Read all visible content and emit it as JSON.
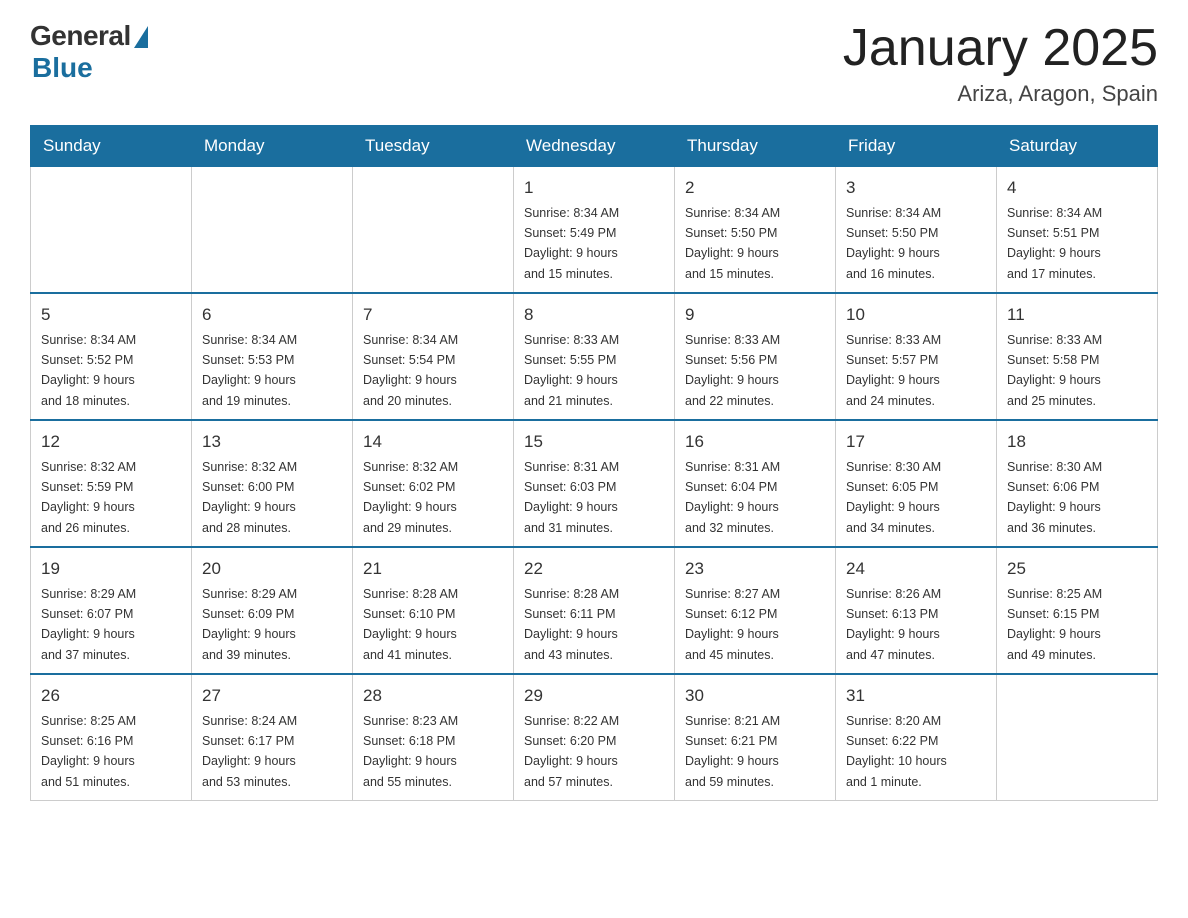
{
  "header": {
    "logo_general": "General",
    "logo_blue": "Blue",
    "title": "January 2025",
    "location": "Ariza, Aragon, Spain"
  },
  "days_of_week": [
    "Sunday",
    "Monday",
    "Tuesday",
    "Wednesday",
    "Thursday",
    "Friday",
    "Saturday"
  ],
  "weeks": [
    [
      {
        "day": "",
        "info": ""
      },
      {
        "day": "",
        "info": ""
      },
      {
        "day": "",
        "info": ""
      },
      {
        "day": "1",
        "info": "Sunrise: 8:34 AM\nSunset: 5:49 PM\nDaylight: 9 hours\nand 15 minutes."
      },
      {
        "day": "2",
        "info": "Sunrise: 8:34 AM\nSunset: 5:50 PM\nDaylight: 9 hours\nand 15 minutes."
      },
      {
        "day": "3",
        "info": "Sunrise: 8:34 AM\nSunset: 5:50 PM\nDaylight: 9 hours\nand 16 minutes."
      },
      {
        "day": "4",
        "info": "Sunrise: 8:34 AM\nSunset: 5:51 PM\nDaylight: 9 hours\nand 17 minutes."
      }
    ],
    [
      {
        "day": "5",
        "info": "Sunrise: 8:34 AM\nSunset: 5:52 PM\nDaylight: 9 hours\nand 18 minutes."
      },
      {
        "day": "6",
        "info": "Sunrise: 8:34 AM\nSunset: 5:53 PM\nDaylight: 9 hours\nand 19 minutes."
      },
      {
        "day": "7",
        "info": "Sunrise: 8:34 AM\nSunset: 5:54 PM\nDaylight: 9 hours\nand 20 minutes."
      },
      {
        "day": "8",
        "info": "Sunrise: 8:33 AM\nSunset: 5:55 PM\nDaylight: 9 hours\nand 21 minutes."
      },
      {
        "day": "9",
        "info": "Sunrise: 8:33 AM\nSunset: 5:56 PM\nDaylight: 9 hours\nand 22 minutes."
      },
      {
        "day": "10",
        "info": "Sunrise: 8:33 AM\nSunset: 5:57 PM\nDaylight: 9 hours\nand 24 minutes."
      },
      {
        "day": "11",
        "info": "Sunrise: 8:33 AM\nSunset: 5:58 PM\nDaylight: 9 hours\nand 25 minutes."
      }
    ],
    [
      {
        "day": "12",
        "info": "Sunrise: 8:32 AM\nSunset: 5:59 PM\nDaylight: 9 hours\nand 26 minutes."
      },
      {
        "day": "13",
        "info": "Sunrise: 8:32 AM\nSunset: 6:00 PM\nDaylight: 9 hours\nand 28 minutes."
      },
      {
        "day": "14",
        "info": "Sunrise: 8:32 AM\nSunset: 6:02 PM\nDaylight: 9 hours\nand 29 minutes."
      },
      {
        "day": "15",
        "info": "Sunrise: 8:31 AM\nSunset: 6:03 PM\nDaylight: 9 hours\nand 31 minutes."
      },
      {
        "day": "16",
        "info": "Sunrise: 8:31 AM\nSunset: 6:04 PM\nDaylight: 9 hours\nand 32 minutes."
      },
      {
        "day": "17",
        "info": "Sunrise: 8:30 AM\nSunset: 6:05 PM\nDaylight: 9 hours\nand 34 minutes."
      },
      {
        "day": "18",
        "info": "Sunrise: 8:30 AM\nSunset: 6:06 PM\nDaylight: 9 hours\nand 36 minutes."
      }
    ],
    [
      {
        "day": "19",
        "info": "Sunrise: 8:29 AM\nSunset: 6:07 PM\nDaylight: 9 hours\nand 37 minutes."
      },
      {
        "day": "20",
        "info": "Sunrise: 8:29 AM\nSunset: 6:09 PM\nDaylight: 9 hours\nand 39 minutes."
      },
      {
        "day": "21",
        "info": "Sunrise: 8:28 AM\nSunset: 6:10 PM\nDaylight: 9 hours\nand 41 minutes."
      },
      {
        "day": "22",
        "info": "Sunrise: 8:28 AM\nSunset: 6:11 PM\nDaylight: 9 hours\nand 43 minutes."
      },
      {
        "day": "23",
        "info": "Sunrise: 8:27 AM\nSunset: 6:12 PM\nDaylight: 9 hours\nand 45 minutes."
      },
      {
        "day": "24",
        "info": "Sunrise: 8:26 AM\nSunset: 6:13 PM\nDaylight: 9 hours\nand 47 minutes."
      },
      {
        "day": "25",
        "info": "Sunrise: 8:25 AM\nSunset: 6:15 PM\nDaylight: 9 hours\nand 49 minutes."
      }
    ],
    [
      {
        "day": "26",
        "info": "Sunrise: 8:25 AM\nSunset: 6:16 PM\nDaylight: 9 hours\nand 51 minutes."
      },
      {
        "day": "27",
        "info": "Sunrise: 8:24 AM\nSunset: 6:17 PM\nDaylight: 9 hours\nand 53 minutes."
      },
      {
        "day": "28",
        "info": "Sunrise: 8:23 AM\nSunset: 6:18 PM\nDaylight: 9 hours\nand 55 minutes."
      },
      {
        "day": "29",
        "info": "Sunrise: 8:22 AM\nSunset: 6:20 PM\nDaylight: 9 hours\nand 57 minutes."
      },
      {
        "day": "30",
        "info": "Sunrise: 8:21 AM\nSunset: 6:21 PM\nDaylight: 9 hours\nand 59 minutes."
      },
      {
        "day": "31",
        "info": "Sunrise: 8:20 AM\nSunset: 6:22 PM\nDaylight: 10 hours\nand 1 minute."
      },
      {
        "day": "",
        "info": ""
      }
    ]
  ]
}
